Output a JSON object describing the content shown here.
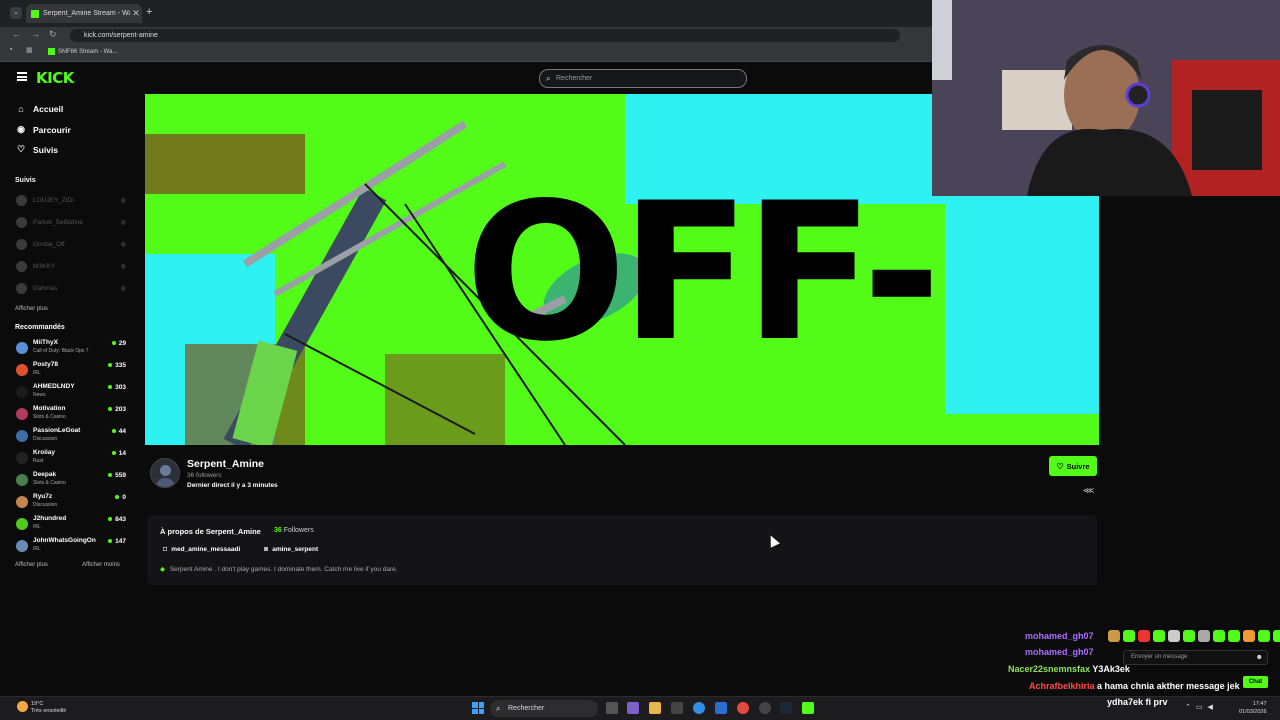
{
  "browser": {
    "tab_title": "Serpent_Amine Stream - Watc",
    "tab_close": "✕",
    "new_tab": "+",
    "url": "kick.com/serpent-amine",
    "bookmark": "SMF86 Stream - Wa..."
  },
  "header": {
    "logo": "KICK",
    "search_placeholder": "Rechercher"
  },
  "sidebar": {
    "nav": [
      {
        "label": "Accueil",
        "icon": "home-icon",
        "glyph": "⌂"
      },
      {
        "label": "Parcourir",
        "icon": "compass-icon",
        "glyph": "◉"
      },
      {
        "label": "Suivis",
        "icon": "heart-icon",
        "glyph": "♡"
      }
    ],
    "following_title": "Suivis",
    "following": [
      {
        "name": "LOUJEY_ZIDI"
      },
      {
        "name": "Parker_Seifddine"
      },
      {
        "name": "Gooba_Off"
      },
      {
        "name": "M3KKY"
      },
      {
        "name": "Dahmas"
      }
    ],
    "following_more": "Afficher plus",
    "recommended_title": "Recommandés",
    "recommended": [
      {
        "name": "MiiThyX",
        "category": "Call of Duty: Black Ops 7",
        "viewers": "29",
        "color": "#5a8fd8"
      },
      {
        "name": "Posty78",
        "category": "IRL",
        "viewers": "335",
        "color": "#e0522b"
      },
      {
        "name": "AHMEDLNDY",
        "category": "News",
        "viewers": "303",
        "color": "#1b1b1b"
      },
      {
        "name": "Motivation",
        "category": "Slots & Casino",
        "viewers": "203",
        "color": "#b23a5a"
      },
      {
        "name": "PassionLeGoat",
        "category": "Discussion",
        "viewers": "44",
        "color": "#3a6ea8"
      },
      {
        "name": "Kroiiay",
        "category": "Rust",
        "viewers": "14",
        "color": "#222"
      },
      {
        "name": "Deepak",
        "category": "Slots & Casino",
        "viewers": "559",
        "color": "#4b7d4b"
      },
      {
        "name": "Ryu7z",
        "category": "Discussion",
        "viewers": "0",
        "color": "#c7864d"
      },
      {
        "name": "J2hundred",
        "category": "IRL",
        "viewers": "843",
        "color": "#53c81c"
      },
      {
        "name": "JohnWhatsGoingOn",
        "category": "IRL",
        "viewers": "147",
        "color": "#6b8bb5"
      }
    ],
    "show_more": "Afficher plus",
    "show_less": "Afficher moins"
  },
  "banner": {
    "text": "OFF-"
  },
  "channel": {
    "name": "Serpent_Amine",
    "followers": "36 followers",
    "last_live": "Dernier direct il y a 3 minutes",
    "follow_label": "Suivre"
  },
  "about": {
    "title": "À propos de Serpent_Amine",
    "followers_count": "36",
    "followers_label": "Followers",
    "instagram": "med_amine_messaadi",
    "discord": "amine_serpent",
    "description": "Serpent Amine . I don't play games. I dominate them. Catch me live if you dare."
  },
  "chat": {
    "lines": [
      {
        "user": "mohamed_gh07",
        "message": "",
        "color": "#a970ff"
      },
      {
        "user": "mohamed_gh07",
        "message": "",
        "color": "#a970ff"
      },
      {
        "user": "Nacer22snemnsfax",
        "message": "Y3Ak3ek",
        "color": "#8de25c"
      },
      {
        "user": "Achrafbelkhiria",
        "message": "a hama chnia akther message jek",
        "color": "#ff4a4a"
      },
      {
        "user": "",
        "message": "ydha7ek fi prv",
        "color": "#ffffff"
      }
    ],
    "input_placeholder": "Envoyer un message",
    "send_label": "Chat"
  },
  "taskbar": {
    "temperature": "19°C",
    "weather": "Très ensoleillé",
    "search": "Rechercher",
    "time": "17:47",
    "date": "01/03/2026"
  }
}
